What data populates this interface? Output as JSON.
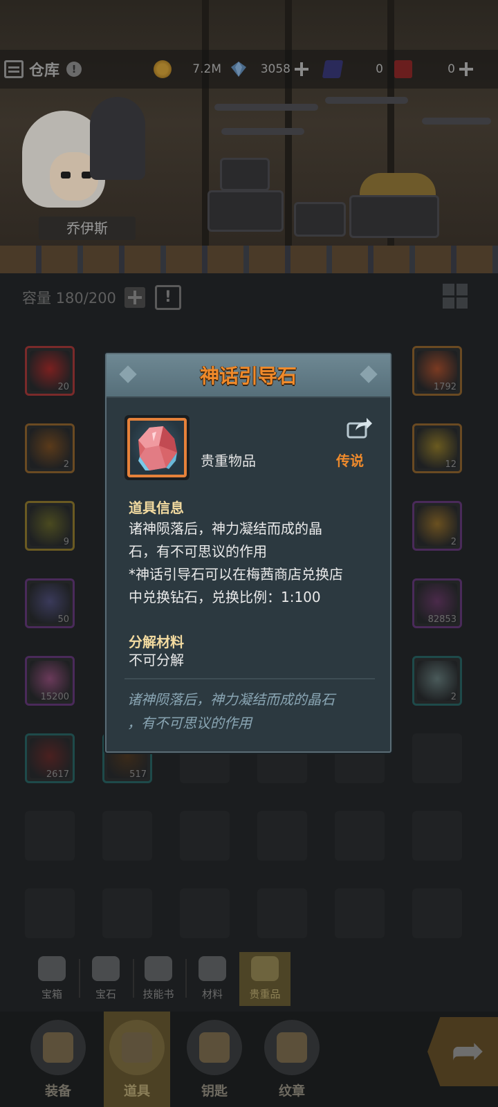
{
  "topbar": {
    "title": "仓库",
    "info_icon": "!",
    "gold": "7.2M",
    "diamond": "3058",
    "ticket_blue": "0",
    "ticket_red": "0"
  },
  "hero": {
    "name": "乔伊斯"
  },
  "capacity": {
    "label": "容量 180/200",
    "sort_icon": "!"
  },
  "inventory": [
    {
      "qty": "20",
      "border": "#7a2a2a",
      "color": "#7a2020"
    },
    {
      "qty": "1792",
      "border": "#6a4a22",
      "color": "#7a3a22"
    },
    {
      "qty": "2",
      "border": "#6a4a22",
      "color": "#5a3a1a"
    },
    {
      "qty": "12",
      "border": "#6a4a22",
      "color": "#6a5a20"
    },
    {
      "qty": "9",
      "border": "#6a5a22",
      "color": "#4a4a20"
    },
    {
      "qty": "2",
      "border": "#4a2a5a",
      "color": "#6a5020"
    },
    {
      "qty": "50",
      "border": "#4a2a5a",
      "color": "#3a3a5a"
    },
    {
      "qty": "82853",
      "border": "#4a2a5a",
      "color": "#4a2a4a"
    },
    {
      "qty": "15200",
      "border": "#4a2a5a",
      "color": "#6a3a5a"
    },
    {
      "qty": "2",
      "border": "#1e4a4a",
      "color": "#4a5a5a"
    },
    {
      "qty": "2617",
      "border": "#1e4a4a",
      "color": "#4a2020"
    },
    {
      "qty": "517",
      "border": "#1e4a4a",
      "color": "#3a2a1a"
    }
  ],
  "categories": [
    {
      "label": "宝箱",
      "icon": "chest-icon"
    },
    {
      "label": "宝石",
      "icon": "gem-icon"
    },
    {
      "label": "技能书",
      "icon": "book-icon"
    },
    {
      "label": "材料",
      "icon": "material-icon"
    },
    {
      "label": "贵重品",
      "icon": "valuables-icon",
      "active": true
    }
  ],
  "bottom_nav": [
    {
      "label": "装备",
      "icon": "equipment-icon"
    },
    {
      "label": "道具",
      "icon": "items-icon",
      "active": true
    },
    {
      "label": "钥匙",
      "icon": "key-icon"
    },
    {
      "label": "纹章",
      "icon": "emblem-icon"
    }
  ],
  "dialog": {
    "title": "神话引导石",
    "item_type": "贵重物品",
    "rarity": "传说",
    "info_heading": "道具信息",
    "info_lines": [
      "诸神陨落后，神力凝结而成的晶",
      "石，有不可思议的作用",
      "*神话引导石可以在梅茜商店兑换店",
      "中兑换钻石，兑换比例：1:100"
    ],
    "decompose_heading": "分解材料",
    "decompose_text": "不可分解",
    "flavor_lines": [
      "诸神陨落后，神力凝结而成的晶石",
      "，有不可思议的作用"
    ],
    "rarity_color": "#ee8a2c",
    "title_color": "#f08a2a"
  }
}
